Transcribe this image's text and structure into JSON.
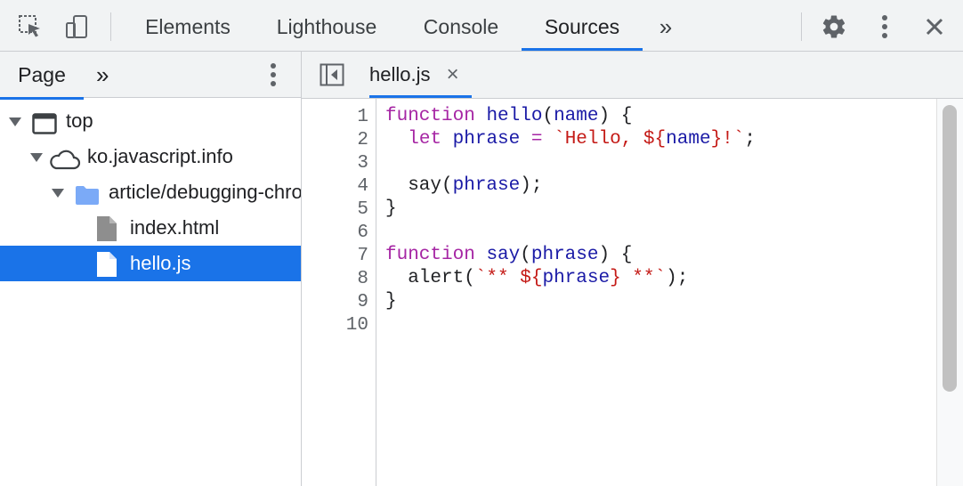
{
  "toolbar": {
    "tabs": [
      {
        "label": "Elements",
        "active": false
      },
      {
        "label": "Lighthouse",
        "active": false
      },
      {
        "label": "Console",
        "active": false
      },
      {
        "label": "Sources",
        "active": true
      }
    ],
    "more_label": "»",
    "icons": [
      "inspect-element-icon",
      "device-toggle-icon",
      "gear-icon",
      "more-vert-icon",
      "close-icon"
    ]
  },
  "navigator": {
    "tabs": [
      {
        "label": "Page",
        "active": true
      }
    ],
    "more_label": "»",
    "tree": [
      {
        "label": "top",
        "icon": "frame-icon",
        "expanded": true,
        "selected": false
      },
      {
        "label": "ko.javascript.info",
        "icon": "cloud-icon",
        "expanded": true,
        "selected": false
      },
      {
        "label": "article/debugging-chrome",
        "icon": "folder-icon",
        "expanded": true,
        "selected": false
      },
      {
        "label": "index.html",
        "icon": "file-icon",
        "expanded": false,
        "selected": false
      },
      {
        "label": "hello.js",
        "icon": "file-icon",
        "expanded": false,
        "selected": true
      }
    ]
  },
  "editor": {
    "file_tab": "hello.js",
    "close_label": "×",
    "line_numbers": [
      "1",
      "2",
      "3",
      "4",
      "5",
      "6",
      "7",
      "8",
      "9",
      "10"
    ],
    "code": [
      {
        "kw": "function",
        "rest": " hello(name) {"
      },
      {
        "text": "  let phrase = `Hello, ${name}!`;"
      },
      {
        "text": ""
      },
      {
        "text": "  say(phrase);"
      },
      {
        "text": "}"
      },
      {
        "text": ""
      },
      {
        "kw": "function",
        "rest": " say(phrase) {"
      },
      {
        "text": "  alert(`** ${phrase} **`);"
      },
      {
        "text": "}"
      },
      {
        "text": ""
      }
    ]
  },
  "colors": {
    "accent": "#1a73e8",
    "selection": "#1a73e8",
    "toolbar_bg": "#f1f3f4",
    "keyword": "#a626a4",
    "string": "#c41a16",
    "identifier": "#1a1aa6"
  }
}
